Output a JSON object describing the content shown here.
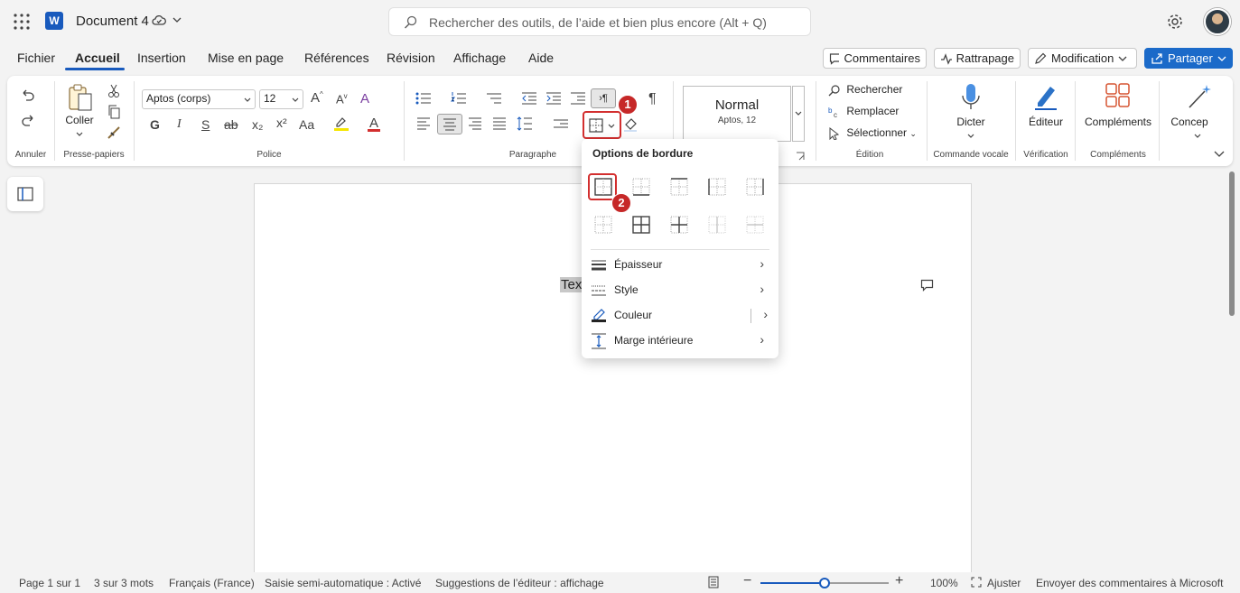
{
  "app": {
    "title": "Document 4",
    "search_placeholder": "Rechercher des outils, de l’aide et bien plus encore (Alt + Q)",
    "logo": "W"
  },
  "tabs": [
    "Fichier",
    "Accueil",
    "Insertion",
    "Mise en page",
    "Références",
    "Révision",
    "Affichage",
    "Aide"
  ],
  "actions": {
    "comments": "Commentaires",
    "catchup": "Rattrapage",
    "editing": "Modification",
    "share": "Partager"
  },
  "ribbon": {
    "undo_group": "Annuler",
    "clipboard": {
      "paste": "Coller",
      "label": "Presse-papiers"
    },
    "font": {
      "name": "Aptos (corps)",
      "size": "12",
      "label": "Police",
      "bold": "G",
      "italic": "I",
      "underline": "S",
      "strike": "ab",
      "subscript": "x₂",
      "superscript": "x²",
      "case": "Aa",
      "color_letter": "A"
    },
    "paragraph": {
      "label": "Paragraphe",
      "pilcrow": "¶",
      "ltr": "›¶"
    },
    "styles": {
      "name": "Normal",
      "desc": "Aptos, 12"
    },
    "editing": {
      "label": "Édition",
      "find": "Rechercher",
      "replace": "Remplacer",
      "select": "Sélectionner"
    },
    "voice": {
      "dictate": "Dicter",
      "label": "Commande vocale"
    },
    "check": {
      "editor": "Éditeur",
      "label": "Vérification"
    },
    "addins": {
      "button": "Compléments",
      "label": "Compléments"
    },
    "designer": {
      "button": "Concep"
    }
  },
  "document": {
    "selected_text": "Tex"
  },
  "callouts": {
    "one": "1",
    "two": "2"
  },
  "border_menu": {
    "title": "Options de bordure",
    "items": [
      "Épaisseur",
      "Style",
      "Couleur",
      "Marge intérieure"
    ]
  },
  "status": {
    "page": "Page 1 sur 1",
    "words": "3 sur 3 mots",
    "language": "Français (France)",
    "autocomplete": "Saisie semi-automatique : Activé",
    "suggestions": "Suggestions de l’éditeur : affichage",
    "zoom": "100%",
    "fit": "Ajuster",
    "feedback": "Envoyer des commentaires à Microsoft",
    "zoom_level": 0.5
  },
  "colors": {
    "accent": "#185abd",
    "highlight_red": "#c62828"
  }
}
